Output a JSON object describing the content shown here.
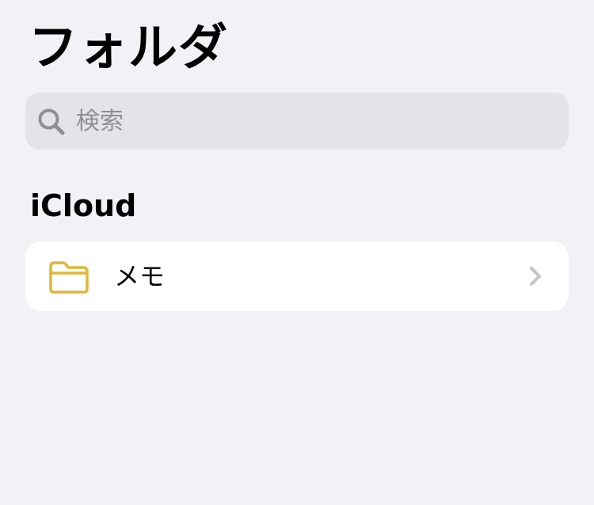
{
  "header": {
    "title": "フォルダ"
  },
  "search": {
    "placeholder": "検索",
    "value": "",
    "icon": "search-icon"
  },
  "sections": [
    {
      "title": "iCloud",
      "folders": [
        {
          "label": "メモ",
          "icon": "folder-icon",
          "icon_color": "#e0b53a",
          "accessory": "chevron-right-icon"
        }
      ]
    }
  ],
  "colors": {
    "background": "#f2f1f6",
    "search_field": "#e4e3e9",
    "placeholder_text": "#8e8e93",
    "card": "#ffffff",
    "folder_accent": "#e0b53a",
    "chevron": "#c4c4c7"
  }
}
